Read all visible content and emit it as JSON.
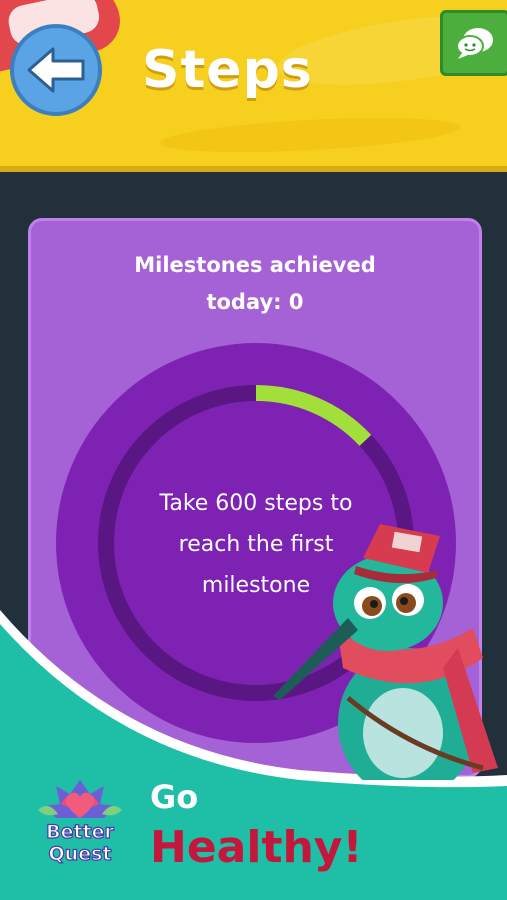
{
  "header": {
    "title": "Steps",
    "back_icon": "arrow-left-icon",
    "chat_icon": "chat-bubble-icon"
  },
  "card": {
    "milestones_line1": "Milestones achieved",
    "milestones_line2": "today: 0",
    "progress_fraction": 0.13,
    "instruction_line1": "Take 600 steps to",
    "instruction_line2": "reach the first",
    "instruction_line3": "milestone"
  },
  "banner": {
    "go": "Go",
    "healthy": "Healthy!",
    "logo_line1": "Better",
    "logo_line2": "Quest"
  },
  "colors": {
    "header_yellow": "#f6cf1f",
    "card_purple": "#a561d6",
    "ring_purple": "#7e22b3",
    "progress_green": "#a3df3a",
    "banner_teal": "#1fbfa7",
    "healthy_red": "#c4173c"
  }
}
